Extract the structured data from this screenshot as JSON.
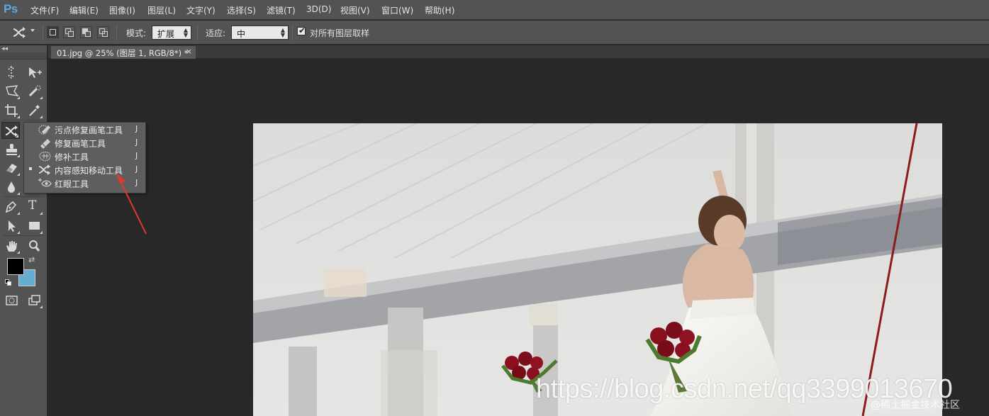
{
  "app": {
    "logo": "Ps"
  },
  "menu": [
    {
      "label": "文件(F)"
    },
    {
      "label": "编辑(E)"
    },
    {
      "label": "图像(I)"
    },
    {
      "label": "图层(L)"
    },
    {
      "label": "文字(Y)"
    },
    {
      "label": "选择(S)"
    },
    {
      "label": "滤镜(T)"
    },
    {
      "label": "3D(D)"
    },
    {
      "label": "视图(V)"
    },
    {
      "label": "窗口(W)"
    },
    {
      "label": "帮助(H)"
    }
  ],
  "options": {
    "mode_label": "模式:",
    "mode_value": "扩展",
    "adapt_label": "适应:",
    "adapt_value": "中",
    "sample_all_label": "对所有图层取样",
    "sample_all_checked": true
  },
  "document": {
    "tab_title": "01.jpg @ 25% (图层 1, RGB/8*) *",
    "close_glyph": "×"
  },
  "colors": {
    "foreground": "#000000",
    "background": "#63aed1",
    "annotation_arrow": "#e03a2e"
  },
  "flyout": {
    "items": [
      {
        "label": "污点修复画笔工具",
        "shortcut": "J",
        "icon": "spot-healing-brush-icon",
        "selected": false
      },
      {
        "label": "修复画笔工具",
        "shortcut": "J",
        "icon": "healing-brush-icon",
        "selected": false
      },
      {
        "label": "修补工具",
        "shortcut": "J",
        "icon": "patch-icon",
        "selected": false
      },
      {
        "label": "内容感知移动工具",
        "shortcut": "J",
        "icon": "content-aware-move-icon",
        "selected": true
      },
      {
        "label": "红眼工具",
        "shortcut": "J",
        "icon": "red-eye-icon",
        "selected": false
      }
    ]
  },
  "toolbox": {
    "tools": [
      "move-tool-icon",
      "artboard-icon",
      "lasso-icon",
      "quick-selection-icon",
      "crop-icon",
      "eyedropper-icon",
      "content-aware-move-icon",
      "stamp-icon",
      "eraser-icon",
      "blur-icon",
      "pen-icon",
      "type-icon",
      "path-selection-icon",
      "rectangle-icon",
      "hand-icon",
      "zoom-icon",
      "quick-mask-icon",
      "screen-mode-icon"
    ],
    "type_glyph": "T"
  },
  "watermarks": {
    "url": "https://blog.csdn.net/qq3399013670",
    "community": "@稀土掘金技术社区"
  }
}
